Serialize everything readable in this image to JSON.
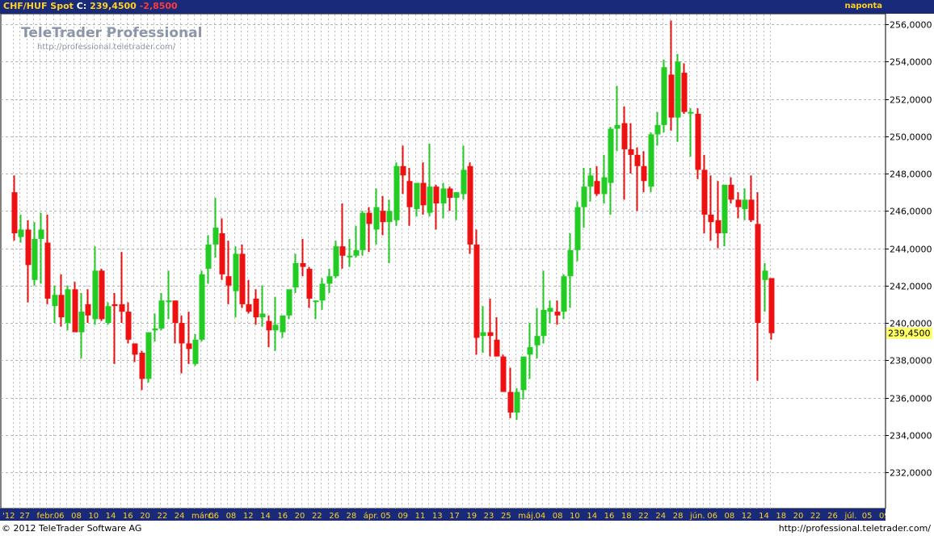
{
  "header": {
    "instrument": "CHF/HUF Spot",
    "close_label": "C:",
    "close_value": "239,4500",
    "change": "-2,8500",
    "period": "naponta"
  },
  "branding": {
    "name": "TeleTrader Professional",
    "url": "http://professional.teletrader.com/"
  },
  "footer": {
    "copyright": "© 2012 TeleTrader Software AG",
    "url": "http://professional.teletrader.com/"
  },
  "colors": {
    "up": "#22cc22",
    "down": "#ee1111",
    "bar_bg": "#1a2a7a",
    "grid": "#b4b4b4",
    "last_price_bg": "#ffff66"
  },
  "chart_data": {
    "type": "candlestick",
    "ylim": [
      230,
      257
    ],
    "yticks": [
      "256,0000",
      "254,0000",
      "252,0000",
      "250,0000",
      "248,0000",
      "246,0000",
      "244,0000",
      "242,0000",
      "240,0000",
      "238,0000",
      "236,0000",
      "234,0000",
      "232,0000"
    ],
    "last_price": "239,4500",
    "grid": true,
    "x_labels": [
      "'12",
      "27",
      "febr.",
      "06",
      "08",
      "10",
      "14",
      "16",
      "20",
      "22",
      "24",
      "márc.",
      "06",
      "08",
      "12",
      "14",
      "16",
      "20",
      "22",
      "26",
      "28",
      "ápr.",
      "05",
      "09",
      "11",
      "13",
      "17",
      "19",
      "23",
      "25",
      "máj.",
      "04",
      "08",
      "10",
      "14",
      "16",
      "18",
      "22",
      "24",
      "28",
      "jún.",
      "06",
      "08",
      "12",
      "14",
      "18",
      "20",
      "22",
      "26",
      "júl.",
      "05",
      "09"
    ],
    "candles": [
      {
        "o": 247.0,
        "h": 247.9,
        "l": 244.4,
        "c": 244.8
      },
      {
        "o": 244.6,
        "h": 245.8,
        "l": 244.3,
        "c": 245.0
      },
      {
        "o": 245.0,
        "h": 245.5,
        "l": 241.1,
        "c": 243.1
      },
      {
        "o": 242.3,
        "h": 245.4,
        "l": 242.0,
        "c": 244.5
      },
      {
        "o": 244.5,
        "h": 245.9,
        "l": 242.1,
        "c": 245.0
      },
      {
        "o": 244.3,
        "h": 245.8,
        "l": 241.0,
        "c": 241.3
      },
      {
        "o": 240.9,
        "h": 242.0,
        "l": 240.0,
        "c": 241.5
      },
      {
        "o": 241.5,
        "h": 242.6,
        "l": 239.8,
        "c": 240.3
      },
      {
        "o": 240.0,
        "h": 242.0,
        "l": 239.6,
        "c": 241.8
      },
      {
        "o": 241.8,
        "h": 242.2,
        "l": 240.0,
        "c": 239.5
      },
      {
        "o": 239.5,
        "h": 241.6,
        "l": 238.1,
        "c": 240.6
      },
      {
        "o": 241.0,
        "h": 241.8,
        "l": 240.0,
        "c": 240.4
      },
      {
        "o": 240.2,
        "h": 244.1,
        "l": 239.9,
        "c": 242.8
      },
      {
        "o": 242.8,
        "h": 242.9,
        "l": 240.1,
        "c": 240.2
      },
      {
        "o": 240.0,
        "h": 241.1,
        "l": 239.9,
        "c": 240.9
      },
      {
        "o": 241.0,
        "h": 241.6,
        "l": 237.8,
        "c": 240.9
      },
      {
        "o": 241.0,
        "h": 243.8,
        "l": 240.0,
        "c": 240.6
      },
      {
        "o": 240.6,
        "h": 241.1,
        "l": 238.9,
        "c": 239.1
      },
      {
        "o": 238.9,
        "h": 238.9,
        "l": 237.9,
        "c": 238.3
      },
      {
        "o": 238.4,
        "h": 238.5,
        "l": 236.4,
        "c": 237.0
      },
      {
        "o": 237.0,
        "h": 239.1,
        "l": 236.8,
        "c": 239.5
      },
      {
        "o": 239.6,
        "h": 240.5,
        "l": 239.0,
        "c": 239.7
      },
      {
        "o": 239.7,
        "h": 241.6,
        "l": 239.6,
        "c": 241.2
      },
      {
        "o": 241.2,
        "h": 242.8,
        "l": 240.2,
        "c": 241.2
      },
      {
        "o": 241.2,
        "h": 241.1,
        "l": 238.9,
        "c": 240.0
      },
      {
        "o": 240.0,
        "h": 240.4,
        "l": 237.3,
        "c": 238.9
      },
      {
        "o": 238.9,
        "h": 240.6,
        "l": 237.8,
        "c": 238.6
      },
      {
        "o": 237.8,
        "h": 239.4,
        "l": 237.7,
        "c": 239.1
      },
      {
        "o": 239.1,
        "h": 242.8,
        "l": 239.0,
        "c": 242.6
      },
      {
        "o": 242.9,
        "h": 244.7,
        "l": 242.1,
        "c": 244.2
      },
      {
        "o": 244.2,
        "h": 246.7,
        "l": 243.5,
        "c": 245.1
      },
      {
        "o": 244.8,
        "h": 245.6,
        "l": 242.3,
        "c": 242.6
      },
      {
        "o": 242.5,
        "h": 244.4,
        "l": 241.0,
        "c": 242.0
      },
      {
        "o": 241.7,
        "h": 244.1,
        "l": 240.3,
        "c": 243.7
      },
      {
        "o": 243.7,
        "h": 244.2,
        "l": 240.8,
        "c": 241.0
      },
      {
        "o": 241.0,
        "h": 242.3,
        "l": 240.5,
        "c": 240.6
      },
      {
        "o": 241.3,
        "h": 241.8,
        "l": 239.9,
        "c": 240.3
      },
      {
        "o": 240.3,
        "h": 242.0,
        "l": 239.8,
        "c": 240.5
      },
      {
        "o": 240.1,
        "h": 240.4,
        "l": 238.7,
        "c": 239.6
      },
      {
        "o": 239.6,
        "h": 241.4,
        "l": 238.5,
        "c": 239.9
      },
      {
        "o": 239.5,
        "h": 240.4,
        "l": 239.2,
        "c": 240.4
      },
      {
        "o": 240.4,
        "h": 241.7,
        "l": 240.2,
        "c": 241.8
      },
      {
        "o": 241.9,
        "h": 243.7,
        "l": 241.6,
        "c": 243.2
      },
      {
        "o": 243.2,
        "h": 244.5,
        "l": 242.5,
        "c": 243.0
      },
      {
        "o": 242.9,
        "h": 243.0,
        "l": 240.8,
        "c": 241.3
      },
      {
        "o": 241.2,
        "h": 241.2,
        "l": 240.2,
        "c": 241.2
      },
      {
        "o": 241.2,
        "h": 242.4,
        "l": 240.7,
        "c": 242.1
      },
      {
        "o": 242.1,
        "h": 242.9,
        "l": 241.6,
        "c": 242.5
      },
      {
        "o": 242.5,
        "h": 244.4,
        "l": 242.4,
        "c": 244.1
      },
      {
        "o": 244.1,
        "h": 246.4,
        "l": 242.9,
        "c": 243.6
      },
      {
        "o": 243.6,
        "h": 244.5,
        "l": 243.0,
        "c": 243.6
      },
      {
        "o": 243.6,
        "h": 245.2,
        "l": 243.5,
        "c": 243.9
      },
      {
        "o": 243.9,
        "h": 246.0,
        "l": 243.6,
        "c": 245.9
      },
      {
        "o": 245.9,
        "h": 246.2,
        "l": 243.8,
        "c": 245.3
      },
      {
        "o": 245.0,
        "h": 247.2,
        "l": 244.2,
        "c": 246.2
      },
      {
        "o": 246.0,
        "h": 246.8,
        "l": 244.7,
        "c": 245.4
      },
      {
        "o": 245.4,
        "h": 246.6,
        "l": 243.2,
        "c": 246.0
      },
      {
        "o": 245.5,
        "h": 248.6,
        "l": 245.2,
        "c": 248.4
      },
      {
        "o": 248.4,
        "h": 249.5,
        "l": 246.9,
        "c": 247.9
      },
      {
        "o": 247.6,
        "h": 248.3,
        "l": 245.2,
        "c": 246.2
      },
      {
        "o": 246.1,
        "h": 247.5,
        "l": 245.7,
        "c": 247.5
      },
      {
        "o": 247.5,
        "h": 248.6,
        "l": 245.8,
        "c": 246.3
      },
      {
        "o": 245.9,
        "h": 249.6,
        "l": 245.7,
        "c": 247.3
      },
      {
        "o": 247.3,
        "h": 247.4,
        "l": 245.0,
        "c": 246.4
      },
      {
        "o": 246.4,
        "h": 247.5,
        "l": 245.6,
        "c": 247.2
      },
      {
        "o": 247.2,
        "h": 247.3,
        "l": 246.0,
        "c": 246.7
      },
      {
        "o": 246.7,
        "h": 247.0,
        "l": 245.5,
        "c": 247.0
      },
      {
        "o": 246.9,
        "h": 249.5,
        "l": 246.6,
        "c": 248.2
      },
      {
        "o": 248.4,
        "h": 248.6,
        "l": 243.7,
        "c": 244.2
      },
      {
        "o": 244.2,
        "h": 245.0,
        "l": 238.3,
        "c": 239.2
      },
      {
        "o": 239.3,
        "h": 240.9,
        "l": 238.4,
        "c": 239.5
      },
      {
        "o": 239.5,
        "h": 241.3,
        "l": 238.2,
        "c": 239.3
      },
      {
        "o": 239.1,
        "h": 240.3,
        "l": 238.2,
        "c": 238.2
      },
      {
        "o": 238.2,
        "h": 238.3,
        "l": 236.7,
        "c": 236.3
      },
      {
        "o": 236.3,
        "h": 237.6,
        "l": 234.9,
        "c": 235.2
      },
      {
        "o": 235.2,
        "h": 236.5,
        "l": 234.8,
        "c": 236.3
      },
      {
        "o": 236.4,
        "h": 237.9,
        "l": 235.9,
        "c": 238.2
      },
      {
        "o": 238.3,
        "h": 240.0,
        "l": 237.0,
        "c": 238.7
      },
      {
        "o": 238.8,
        "h": 240.8,
        "l": 238.1,
        "c": 239.3
      },
      {
        "o": 239.3,
        "h": 242.8,
        "l": 238.9,
        "c": 240.7
      },
      {
        "o": 240.6,
        "h": 241.2,
        "l": 240.0,
        "c": 240.8
      },
      {
        "o": 240.6,
        "h": 241.2,
        "l": 239.9,
        "c": 240.4
      },
      {
        "o": 240.6,
        "h": 242.6,
        "l": 240.2,
        "c": 242.5
      },
      {
        "o": 242.5,
        "h": 244.8,
        "l": 240.8,
        "c": 243.9
      },
      {
        "o": 243.9,
        "h": 246.5,
        "l": 243.3,
        "c": 246.2
      },
      {
        "o": 246.2,
        "h": 248.3,
        "l": 245.1,
        "c": 247.3
      },
      {
        "o": 247.3,
        "h": 248.3,
        "l": 246.5,
        "c": 247.9
      },
      {
        "o": 247.6,
        "h": 248.4,
        "l": 246.8,
        "c": 246.9
      },
      {
        "o": 246.9,
        "h": 249.0,
        "l": 246.4,
        "c": 247.8
      },
      {
        "o": 247.5,
        "h": 250.5,
        "l": 245.8,
        "c": 250.4
      },
      {
        "o": 250.4,
        "h": 252.7,
        "l": 249.2,
        "c": 250.6
      },
      {
        "o": 250.7,
        "h": 251.6,
        "l": 246.6,
        "c": 249.3
      },
      {
        "o": 249.3,
        "h": 250.7,
        "l": 248.0,
        "c": 249.0
      },
      {
        "o": 249.0,
        "h": 249.4,
        "l": 246.0,
        "c": 248.4
      },
      {
        "o": 248.4,
        "h": 249.2,
        "l": 247.0,
        "c": 247.6
      },
      {
        "o": 247.3,
        "h": 250.2,
        "l": 247.0,
        "c": 250.1
      },
      {
        "o": 250.1,
        "h": 251.3,
        "l": 249.5,
        "c": 250.6
      },
      {
        "o": 250.6,
        "h": 254.1,
        "l": 250.2,
        "c": 253.7
      },
      {
        "o": 253.3,
        "h": 256.2,
        "l": 250.3,
        "c": 251.0
      },
      {
        "o": 251.0,
        "h": 254.4,
        "l": 249.7,
        "c": 254.0
      },
      {
        "o": 253.4,
        "h": 253.9,
        "l": 251.2,
        "c": 251.3
      },
      {
        "o": 251.3,
        "h": 251.5,
        "l": 248.9,
        "c": 251.3
      },
      {
        "o": 251.2,
        "h": 251.5,
        "l": 247.7,
        "c": 248.2
      },
      {
        "o": 248.2,
        "h": 249.0,
        "l": 244.8,
        "c": 245.8
      },
      {
        "o": 245.8,
        "h": 247.9,
        "l": 244.4,
        "c": 245.4
      },
      {
        "o": 245.5,
        "h": 247.6,
        "l": 244.0,
        "c": 244.8
      },
      {
        "o": 244.8,
        "h": 247.4,
        "l": 244.1,
        "c": 247.4
      },
      {
        "o": 247.4,
        "h": 247.8,
        "l": 246.4,
        "c": 246.6
      },
      {
        "o": 246.6,
        "h": 247.0,
        "l": 245.6,
        "c": 246.2
      },
      {
        "o": 246.1,
        "h": 247.2,
        "l": 245.5,
        "c": 246.6
      },
      {
        "o": 246.6,
        "h": 247.9,
        "l": 245.4,
        "c": 245.5
      },
      {
        "o": 245.3,
        "h": 247.0,
        "l": 236.9,
        "c": 240.0
      },
      {
        "o": 242.3,
        "h": 243.2,
        "l": 240.6,
        "c": 242.8
      },
      {
        "o": 242.4,
        "h": 242.4,
        "l": 239.1,
        "c": 239.45
      }
    ]
  }
}
